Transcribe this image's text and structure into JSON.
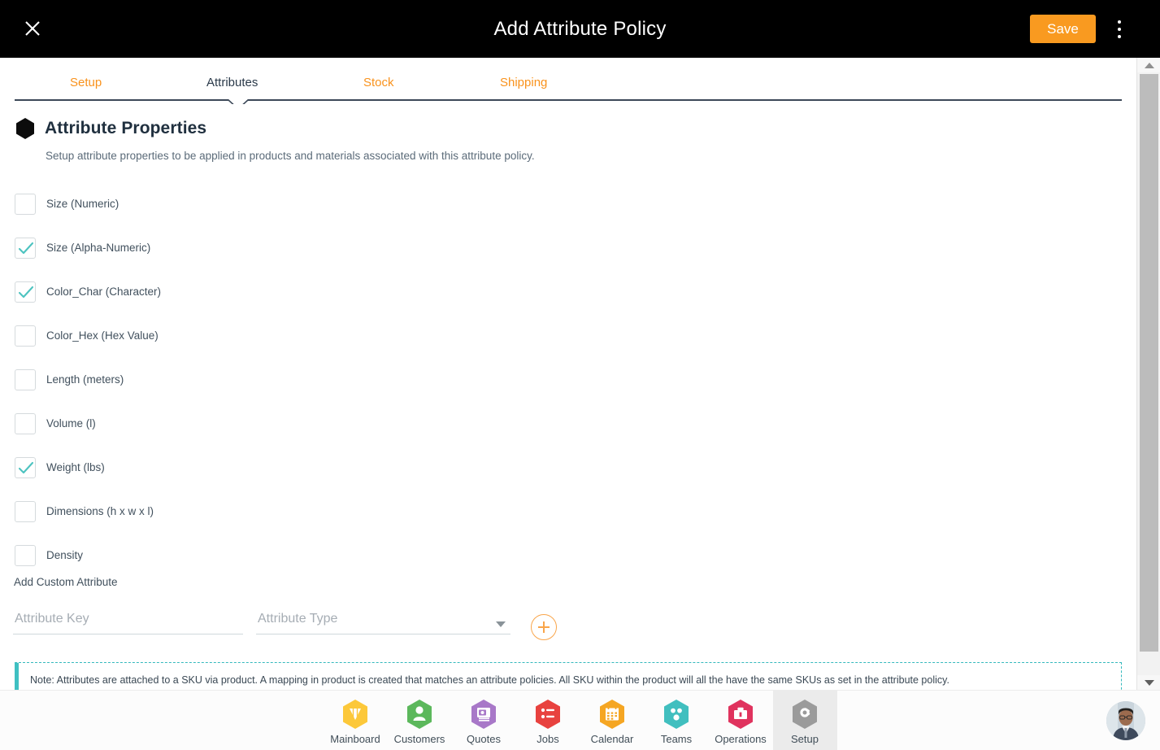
{
  "topbar": {
    "close_icon": "close-icon",
    "title": "Add Attribute Policy",
    "save_label": "Save",
    "menu_icon": "kebab-menu-icon",
    "background": "#000000",
    "accent": "#F99A20"
  },
  "tabs": [
    {
      "label": "Setup",
      "active": false
    },
    {
      "label": "Attributes",
      "active": true
    },
    {
      "label": "Stock",
      "active": false
    },
    {
      "label": "Shipping",
      "active": false
    }
  ],
  "section": {
    "bullet_icon": "hexagon-bullet-icon",
    "title": "Attribute Properties",
    "subtitle": "Setup attribute properties to be applied in products and materials associated with this attribute policy."
  },
  "attributes": [
    {
      "label": "Size (Numeric)",
      "checked": false
    },
    {
      "label": "Size (Alpha-Numeric)",
      "checked": true
    },
    {
      "label": "Color_Char (Character)",
      "checked": true
    },
    {
      "label": "Color_Hex (Hex Value)",
      "checked": false
    },
    {
      "label": "Length (meters)",
      "checked": false
    },
    {
      "label": "Volume (l)",
      "checked": false
    },
    {
      "label": "Weight (lbs)",
      "checked": true
    },
    {
      "label": "Dimensions (h x w x l)",
      "checked": false
    },
    {
      "label": "Density",
      "checked": false
    }
  ],
  "custom": {
    "heading": "Add Custom Attribute",
    "key_placeholder": "Attribute Key",
    "key_value": "",
    "type_placeholder": "Attribute Type",
    "type_value": "",
    "dropdown_icon": "chevron-down-icon",
    "add_icon": "plus-circle-icon"
  },
  "note": {
    "text": "Note: Attributes are attached to a SKU via product. A mapping in product is created that matches an attribute policies. All SKU within the product will all the have the same SKUs as set in the attribute policy.",
    "accent": "#3fc0c2"
  },
  "scrollbar": {
    "up_icon": "scroll-up-arrow-icon",
    "down_icon": "scroll-down-arrow-icon",
    "thumb": "scrollbar-thumb"
  },
  "bottom_nav": {
    "items": [
      {
        "label": "Mainboard",
        "icon": "mainboard-icon",
        "color": "#FCC83A",
        "active": false
      },
      {
        "label": "Customers",
        "icon": "customers-icon",
        "color": "#5CB85C",
        "active": false
      },
      {
        "label": "Quotes",
        "icon": "quotes-icon",
        "color": "#A878C8",
        "active": false
      },
      {
        "label": "Jobs",
        "icon": "jobs-icon",
        "color": "#E8423F",
        "active": false
      },
      {
        "label": "Calendar",
        "icon": "calendar-icon",
        "color": "#F5A623",
        "active": false
      },
      {
        "label": "Teams",
        "icon": "teams-icon",
        "color": "#41BFBF",
        "active": false
      },
      {
        "label": "Operations",
        "icon": "operations-icon",
        "color": "#E0335E",
        "active": false
      },
      {
        "label": "Setup",
        "icon": "setup-gear-icon",
        "color": "#9B9B9B",
        "active": true
      }
    ],
    "avatar": "user-avatar"
  }
}
